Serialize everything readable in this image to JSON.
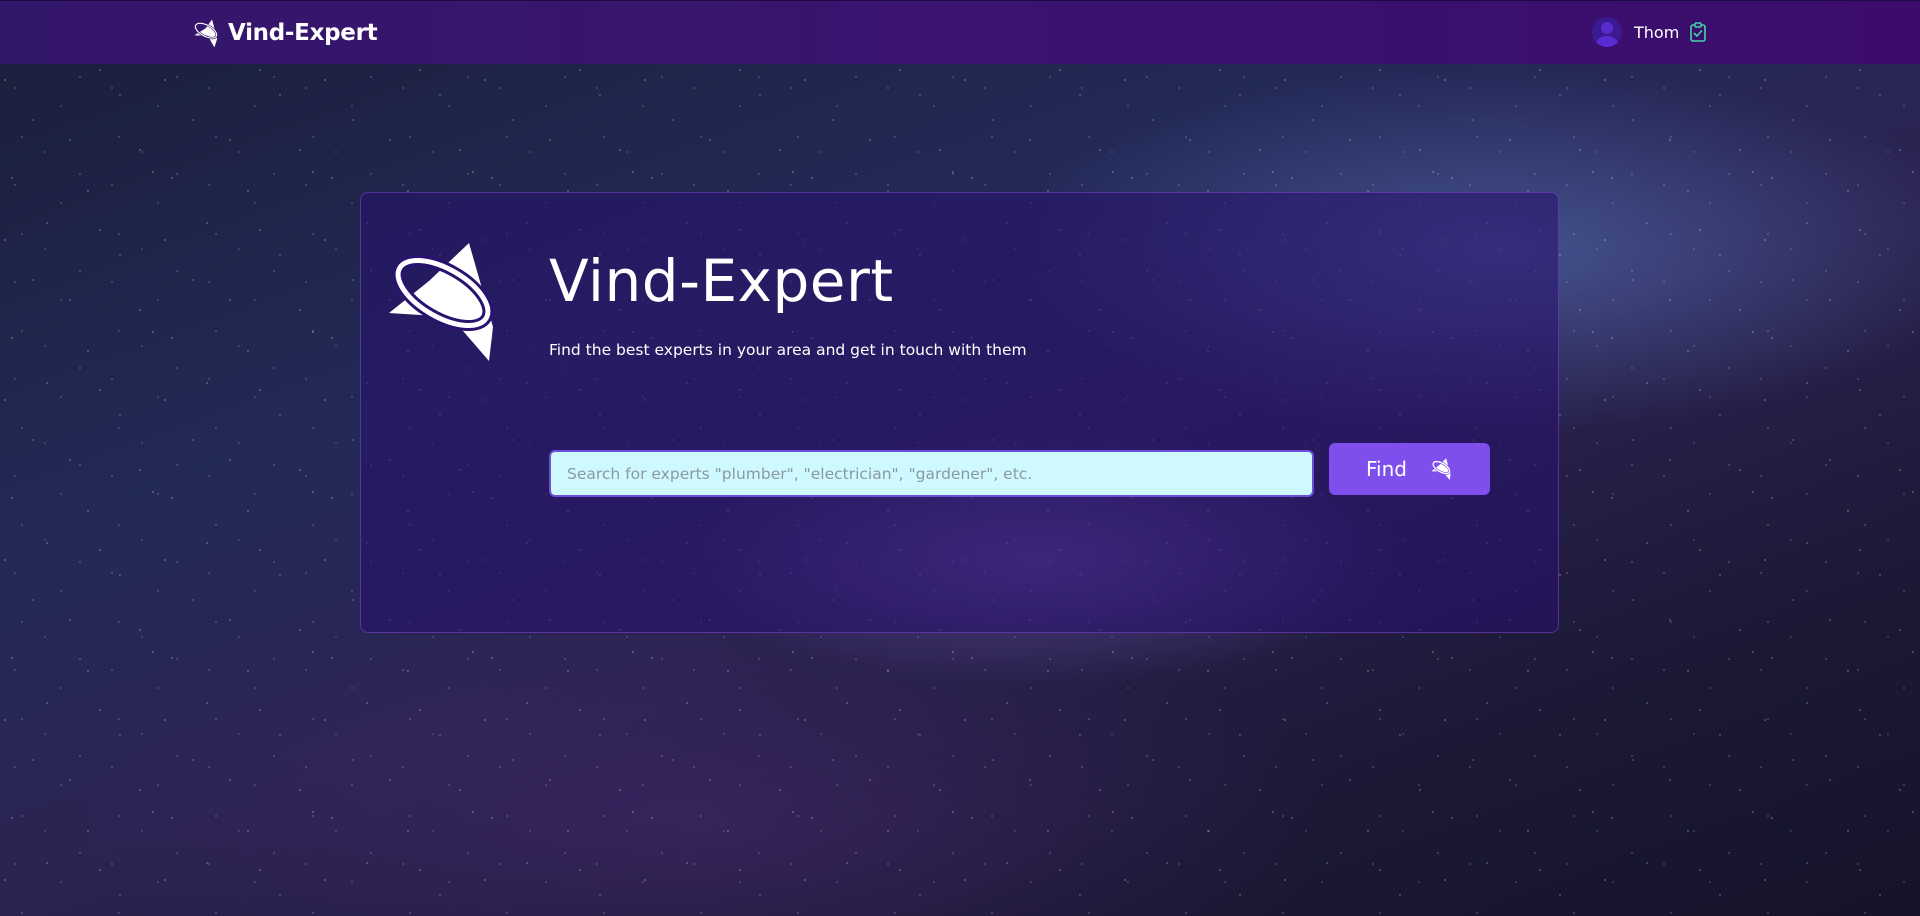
{
  "navbar": {
    "brand_name": "Vind-Expert",
    "brand_icon": "star-planet-logo-icon",
    "user": {
      "name": "Thom",
      "avatar_icon": "user-avatar-icon",
      "tasks_icon": "clipboard-check-icon"
    }
  },
  "hero": {
    "logo_icon": "star-planet-logo-icon",
    "title": "Vind-Expert",
    "subtitle": "Find the best experts in your area and get in touch with them",
    "search": {
      "placeholder": "Search for experts \"plumber\", \"electrician\", \"gardener\", etc.",
      "value": ""
    },
    "find_button": {
      "label": "Find",
      "icon": "star-planet-icon"
    }
  },
  "colors": {
    "navbar": "#3a1470",
    "card": "#28106e",
    "input_bg": "#cef9ff",
    "button": "#7e4fec",
    "clipboard_icon": "#3fd6a6"
  }
}
